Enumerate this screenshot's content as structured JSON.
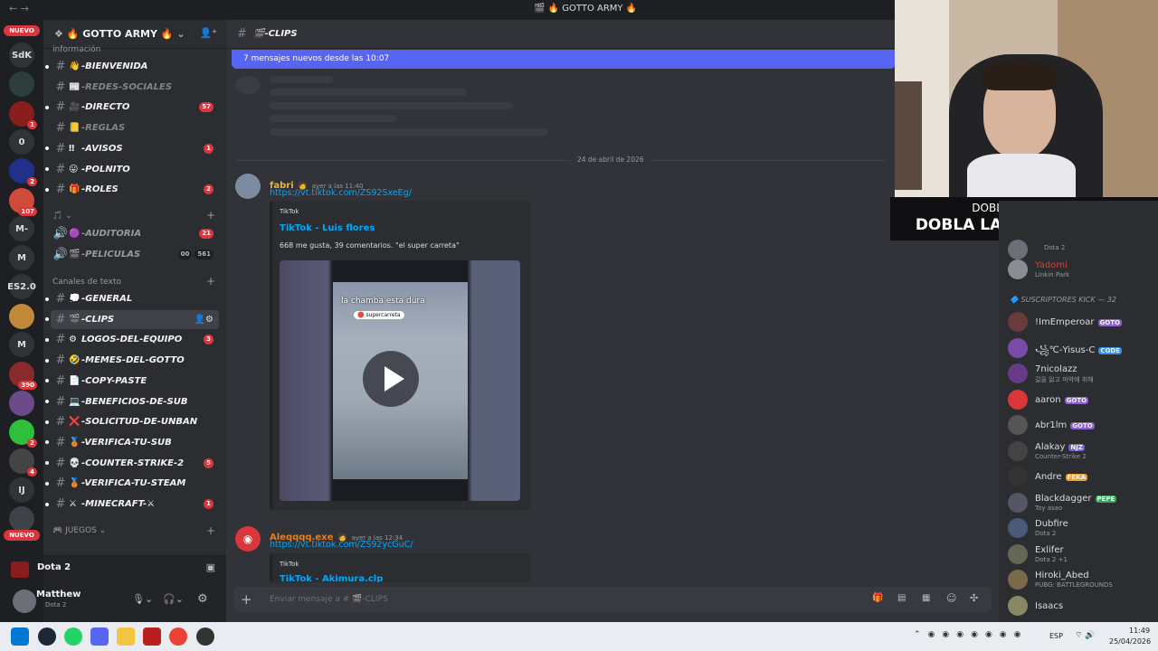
{
  "window": {
    "title": "GOTTO ARMY",
    "title_emoji": "🔥"
  },
  "rail": {
    "nuevo_label": "NUEVO",
    "servers": [
      {
        "label": "SdK",
        "badge": ""
      },
      {
        "label": "",
        "badge": ""
      },
      {
        "label": "",
        "badge": "1"
      },
      {
        "label": "0",
        "badge": ""
      },
      {
        "label": "",
        "badge": "2"
      },
      {
        "label": "",
        "badge": "107"
      },
      {
        "label": "M-",
        "badge": ""
      },
      {
        "label": "M",
        "badge": ""
      },
      {
        "label": "ES2.0",
        "badge": ""
      },
      {
        "label": "",
        "badge": ""
      },
      {
        "label": "M",
        "badge": ""
      },
      {
        "label": "",
        "badge": "390"
      },
      {
        "label": "",
        "badge": ""
      },
      {
        "label": "",
        "badge": "2"
      },
      {
        "label": "",
        "badge": "4"
      },
      {
        "label": "IJ",
        "badge": ""
      },
      {
        "label": "",
        "badge": ""
      }
    ]
  },
  "guild": {
    "name": "GOTTO ARMY",
    "info_category": "información"
  },
  "channels_info": [
    {
      "emoji": "👋",
      "name": "-BIENVENIDA",
      "badge": "",
      "muted": false
    },
    {
      "emoji": "📰",
      "name": "-REDES-SOCIALES",
      "badge": "",
      "muted": true
    },
    {
      "emoji": "🎥",
      "name": "-DIRECTO",
      "badge": "57",
      "muted": false
    },
    {
      "emoji": "📒",
      "name": "-REGLAS",
      "badge": "",
      "muted": true
    },
    {
      "emoji": "‼",
      "name": "-AVISOS",
      "badge": "1",
      "muted": false
    },
    {
      "emoji": "😛",
      "name": "-POLNITO",
      "badge": "",
      "muted": false
    },
    {
      "emoji": "🎁",
      "name": "-ROLES",
      "badge": "2",
      "muted": false
    }
  ],
  "voice_channels": [
    {
      "emoji": "🟣",
      "name": "-AUDITORIA",
      "badge": "21",
      "extra": []
    },
    {
      "emoji": "🎬",
      "name": "-PELICULAS",
      "badge": "",
      "extra": [
        "00",
        "561"
      ]
    }
  ],
  "text_category": "Canales de texto",
  "channels_text": [
    {
      "emoji": "💭",
      "name": "-GENERAL",
      "badge": "",
      "active": false
    },
    {
      "emoji": "🎬",
      "name": "-CLIPS",
      "badge": "",
      "active": true
    },
    {
      "emoji": "⚙",
      "name": "LOGOS-DEL-EQUIPO",
      "badge": "3",
      "active": false
    },
    {
      "emoji": "🤣",
      "name": "-MEMES-DEL-GOTTO",
      "badge": "",
      "active": false
    },
    {
      "emoji": "📄",
      "name": "-COPY-PASTE",
      "badge": "",
      "active": false
    },
    {
      "emoji": "💻",
      "name": "-BENEFICIOS-DE-SUB",
      "badge": "",
      "active": false
    },
    {
      "emoji": "❌",
      "name": "-SOLICITUD-DE-UNBAN",
      "badge": "",
      "active": false
    },
    {
      "emoji": "🥉",
      "name": "-VERIFICA-TU-SUB",
      "badge": "",
      "active": false
    },
    {
      "emoji": "💀",
      "name": "-COUNTER-STRIKE-2",
      "badge": "5",
      "active": false
    },
    {
      "emoji": "🥉",
      "name": "-VERIFICA-TU-STEAM",
      "badge": "",
      "active": false
    },
    {
      "emoji": "⚔",
      "name": "-MINECRAFT-⚔",
      "badge": "1",
      "active": false
    }
  ],
  "games_category": "JUEGOS",
  "voice_status": {
    "label": "Dota 2"
  },
  "user": {
    "name": "Matthew",
    "status": "Dota 2"
  },
  "chat": {
    "channel": "-CLIPS",
    "new_messages_banner": "7 mensajes nuevos desde las 10:07",
    "date_divider": "24 de abril de 2026",
    "messages": [
      {
        "author": "fabri",
        "time": "ayer a las 11:40",
        "link": "https://vt.tiktok.com/ZS92SxeEg/",
        "embed_provider": "TikTok",
        "embed_title": "TikTok - Luis flores",
        "embed_desc": "668 me gusta, 39 comentarios. \"el super carreta\"",
        "video_caption": "la chamba esta dura",
        "video_tag": "supercarreta"
      },
      {
        "author": "Aleqqqq.exe",
        "time": "ayer a las 12:34",
        "link": "https://vt.tiktok.com/ZS92ycGuC/",
        "embed_provider": "TikTok",
        "embed_title": "TikTok - Akimura.clp"
      }
    ],
    "input_placeholder": "Enviar mensaje a # 🎬-CLIPS"
  },
  "promo": {
    "line1": "DOBLA LA ACCION,",
    "line2": "DOBLA LA BONIFICACION"
  },
  "members": {
    "top": [
      {
        "name": "",
        "status": "Dota 2"
      },
      {
        "name": "Yadomi",
        "status": "Linkin Park"
      }
    ],
    "category": "SUSCRIPTORES KICK — 32",
    "list": [
      {
        "name": "!ImEmperoar",
        "tag": "GOTO",
        "status": ""
      },
      {
        "name": "꧁℃-Yisus-C",
        "tag": "CODE",
        "status": ""
      },
      {
        "name": "7nicolazz",
        "tag": "",
        "status": "길을 잃고 마약에 취해"
      },
      {
        "name": "aaron",
        "tag": "GOTO",
        "status": ""
      },
      {
        "name": "ᴀbr1lm",
        "tag": "GOTO",
        "status": ""
      },
      {
        "name": "Alakay",
        "tag": "NJZ",
        "status": "Counter-Strike 2"
      },
      {
        "name": "Andre",
        "tag": "FEKA",
        "status": ""
      },
      {
        "name": "Blackdagger",
        "tag": "PEPE",
        "status": "Toy asao"
      },
      {
        "name": "Dubfire",
        "tag": "",
        "status": "Dota 2"
      },
      {
        "name": "Exlifer",
        "tag": "",
        "status": "Dota 2 +1"
      },
      {
        "name": "Hiroki_Abed",
        "tag": "",
        "status": "PUBG: BATTLEGROUNDS"
      },
      {
        "name": "Isaacs",
        "tag": "",
        "status": ""
      }
    ]
  },
  "taskbar": {
    "lang": "ESP",
    "time": "11:49",
    "date": "25/04/2026"
  },
  "colors": {
    "blurple": "#5865f2",
    "red": "#da373c",
    "link": "#00a8fc",
    "bg": "#313338",
    "sidebar": "#2b2d31"
  }
}
